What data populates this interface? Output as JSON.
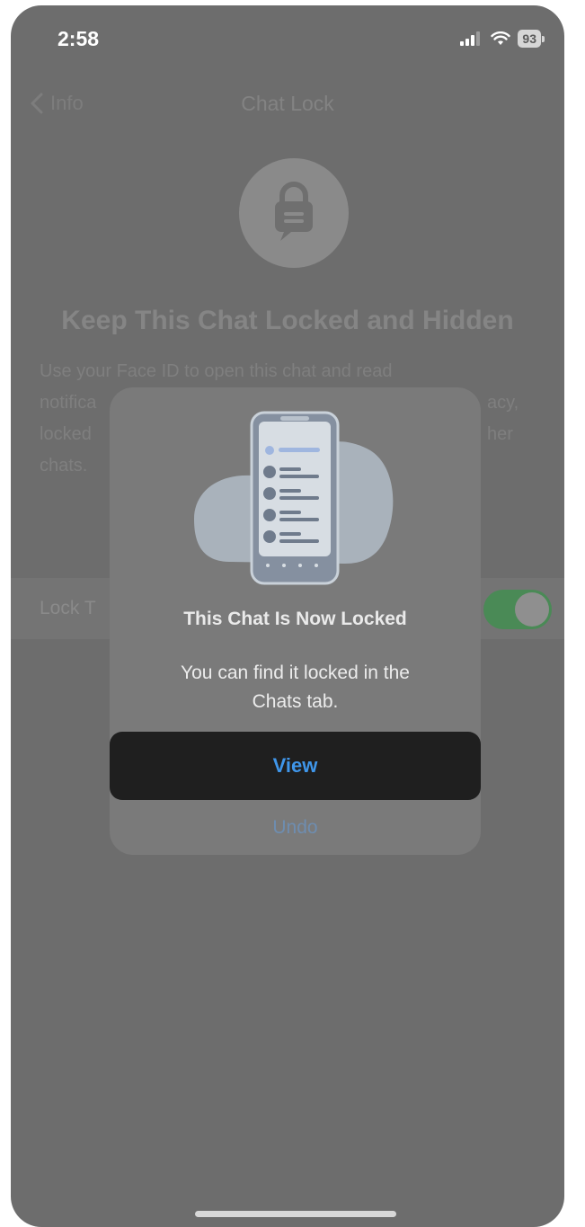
{
  "status_bar": {
    "time": "2:58",
    "battery": "93",
    "icons": [
      "cellular-signal-icon",
      "wifi-icon",
      "battery-icon"
    ]
  },
  "nav": {
    "back_label": "Info",
    "title": "Chat Lock"
  },
  "page": {
    "headline": "Keep This Chat Locked and Hidden",
    "body_lines": [
      "Use your Face ID to open this chat and read",
      "notifica",
      "acy,",
      "locked",
      "her",
      "chats."
    ],
    "lock_row_label": "Lock T",
    "lock_toggle_on": true
  },
  "modal": {
    "title": "This Chat Is Now Locked",
    "message_line1": "You can find it locked in the",
    "message_line2": "Chats tab.",
    "view_label": "View",
    "undo_label": "Undo"
  },
  "colors": {
    "overlay": "#6d6d6d",
    "modal_bg": "#7a7a7a",
    "view_button_bg": "#1f1f1f",
    "accent_blue": "#3f96ea",
    "toggle_on": "#4a8a56"
  }
}
